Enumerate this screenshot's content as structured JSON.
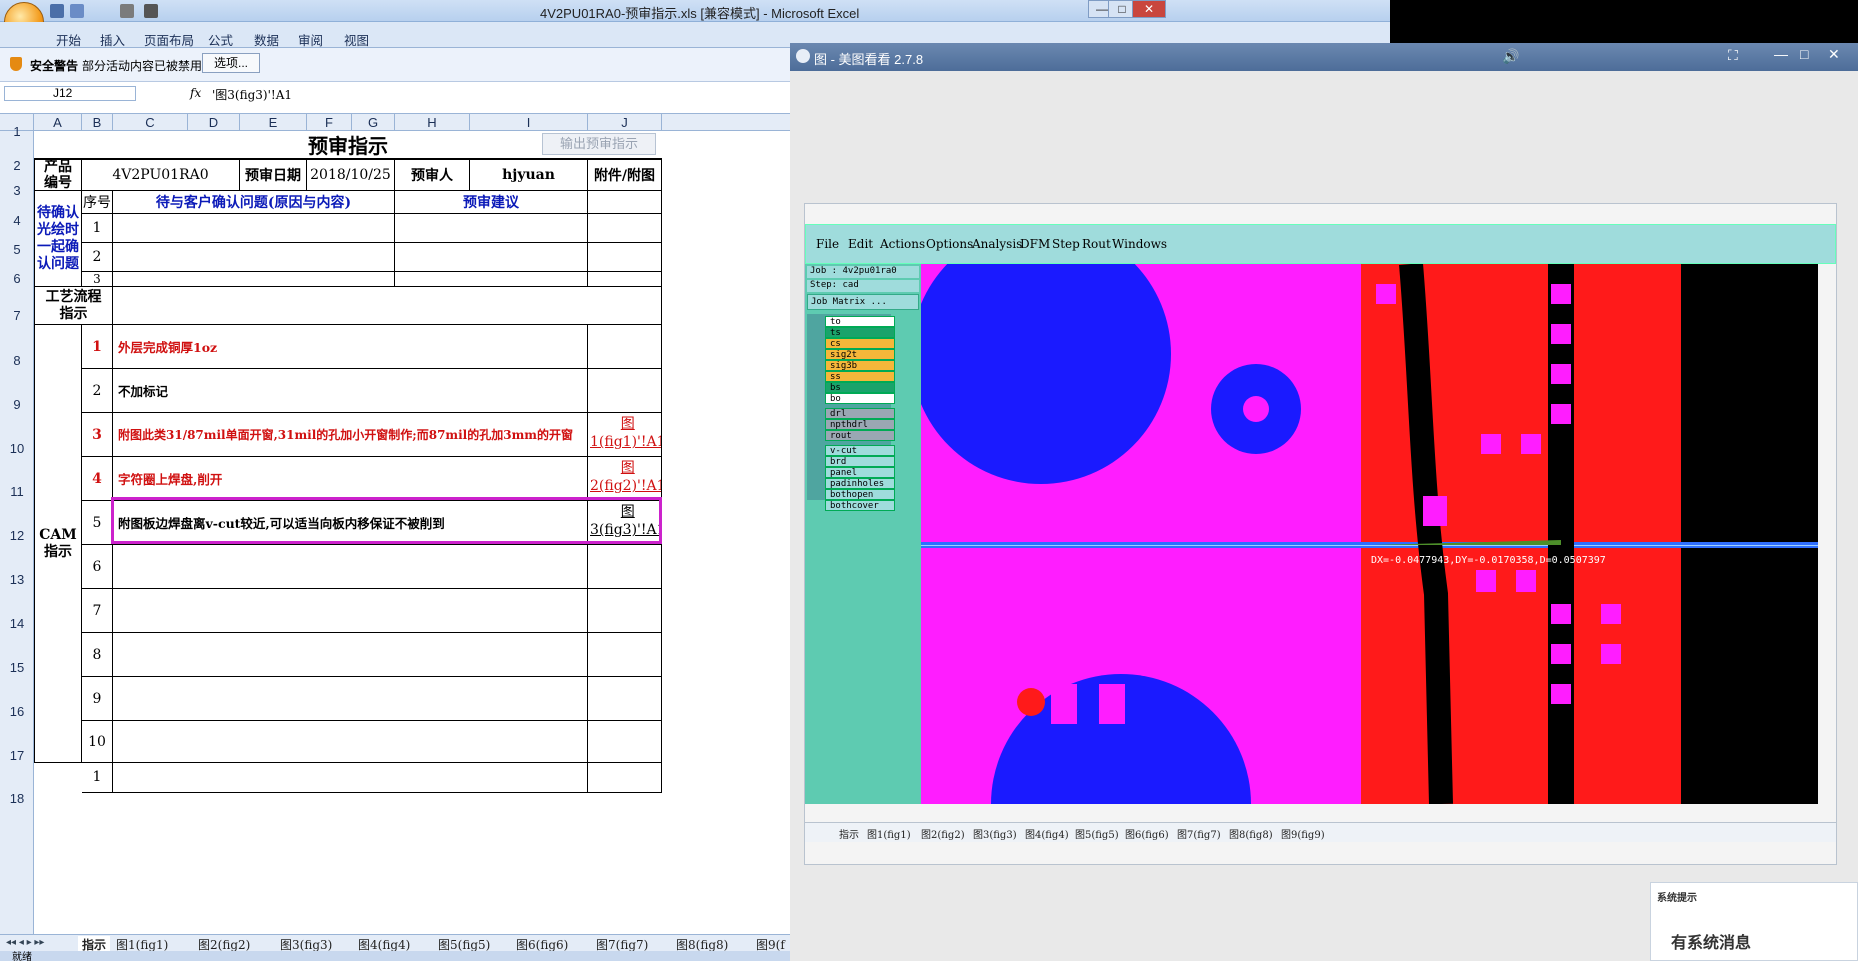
{
  "excel": {
    "window_title": "4V2PU01RA0-预审指示.xls  [兼容模式] - Microsoft Excel",
    "ribbon_tabs": [
      "开始",
      "插入",
      "页面布局",
      "公式",
      "数据",
      "审阅",
      "视图"
    ],
    "security_label": "安全警告",
    "security_message": "部分活动内容已被禁用。",
    "options_button": "选项...",
    "name_box": "J12",
    "fx_symbol": "fx",
    "formula": "'图3(fig3)'!A1",
    "columns": [
      "A",
      "B",
      "C",
      "D",
      "E",
      "F",
      "G",
      "H",
      "I",
      "J"
    ],
    "rows": [
      "1",
      "2",
      "3",
      "4",
      "5",
      "6",
      "7",
      "8",
      "9",
      "10",
      "11",
      "12",
      "13",
      "14",
      "15",
      "16",
      "17",
      "18"
    ],
    "export_button": "输出预审指示",
    "sheet_title": "预审指示",
    "product_label": "产品编号",
    "product_code": "4V2PU01RA0",
    "review_date_label": "预审日期",
    "review_date": "2018/10/25",
    "reviewer_label": "预审人",
    "reviewer": "hjyuan",
    "attach_label": "附件/附图",
    "pending_label": "待确认光绘时一起确认问题",
    "seq_label": "序号",
    "issue_header": "待与客户确认问题(原因与内容)",
    "advice_header": "预审建议",
    "pending_nums": [
      "1",
      "2",
      "3"
    ],
    "process_label": "工艺流程指示",
    "cam_label": "CAM指示",
    "cam_items": [
      {
        "num": "1",
        "text": "外层完成铜厚1oz",
        "link": ""
      },
      {
        "num": "2",
        "text": "不加标记",
        "link": ""
      },
      {
        "num": "3",
        "text": "附图此类31/87mil单面开窗,31mil的孔加小开窗制作;而87mil的孔加3mm的开窗",
        "link": "图1(fig1)'!A1"
      },
      {
        "num": "4",
        "text": "字符圈上焊盘,削开",
        "link": "图2(fig2)'!A1"
      },
      {
        "num": "5",
        "text": "附图板边焊盘离v-cut较近,可以适当向板内移保证不被削到",
        "link": "图3(fig3)'!A1"
      },
      {
        "num": "6",
        "text": "",
        "link": ""
      },
      {
        "num": "7",
        "text": "",
        "link": ""
      },
      {
        "num": "8",
        "text": "",
        "link": ""
      },
      {
        "num": "9",
        "text": "",
        "link": ""
      },
      {
        "num": "10",
        "text": "",
        "link": ""
      },
      {
        "num": "1",
        "text": "",
        "link": ""
      }
    ],
    "sheet_tabs": [
      "指示",
      "图1(fig1)",
      "图2(fig2)",
      "图3(fig3)",
      "图4(fig4)",
      "图5(fig5)",
      "图6(fig6)",
      "图7(fig7)",
      "图8(fig8)",
      "图9(f"
    ],
    "status": "就绪"
  },
  "viewer": {
    "title": "图 - 美图看看 2.7.8",
    "cam": {
      "menu": [
        "File",
        "Edit",
        "Actions",
        "Options",
        "Analysis",
        "DFM",
        "Step",
        "Rout",
        "Windows"
      ],
      "job": "Job : 4v2pu01ra0",
      "step": "Step: cad",
      "matrix_button": "Job Matrix ...",
      "layers": [
        {
          "name": "to",
          "color": "#ffffff"
        },
        {
          "name": "ts",
          "color": "#1aa36b"
        },
        {
          "name": "cs",
          "color": "#f5b73a"
        },
        {
          "name": "sig2t",
          "color": "#f5b73a"
        },
        {
          "name": "sig3b",
          "color": "#f5b73a"
        },
        {
          "name": "ss",
          "color": "#f5b73a"
        },
        {
          "name": "bs",
          "color": "#1aa36b"
        },
        {
          "name": "bo",
          "color": "#ffffff"
        },
        {
          "name": "drl",
          "color": "#9aa7b3"
        },
        {
          "name": "npthdrl",
          "color": "#9aa7b3"
        },
        {
          "name": "rout",
          "color": "#9aa7b3"
        },
        {
          "name": "v-cut",
          "color": "#9fdcdc"
        },
        {
          "name": "brd",
          "color": "#9fdcdc"
        },
        {
          "name": "panel",
          "color": "#9fdcdc"
        },
        {
          "name": "padinholes",
          "color": "#9fdcdc"
        },
        {
          "name": "bothopen",
          "color": "#9fdcdc"
        },
        {
          "name": "bothcover",
          "color": "#9fdcdc"
        }
      ],
      "measure": "DX=-0.0477943,DY=-0.0170358,D=0.0507397",
      "tabs": [
        "指示",
        "图1(fig1)",
        "图2(fig2)",
        "图3(fig3)",
        "图4(fig4)",
        "图5(fig5)",
        "图6(fig6)",
        "图7(fig7)",
        "图8(fig8)",
        "图9(fig9)"
      ]
    },
    "popup_title": "系统提示",
    "popup_message": "有系统消息"
  },
  "colors": {
    "magenta": "#ff1dff",
    "copper_red": "#ff1a1a",
    "pad_blue": "#1a1aff",
    "highlight": "#cc22cc"
  }
}
